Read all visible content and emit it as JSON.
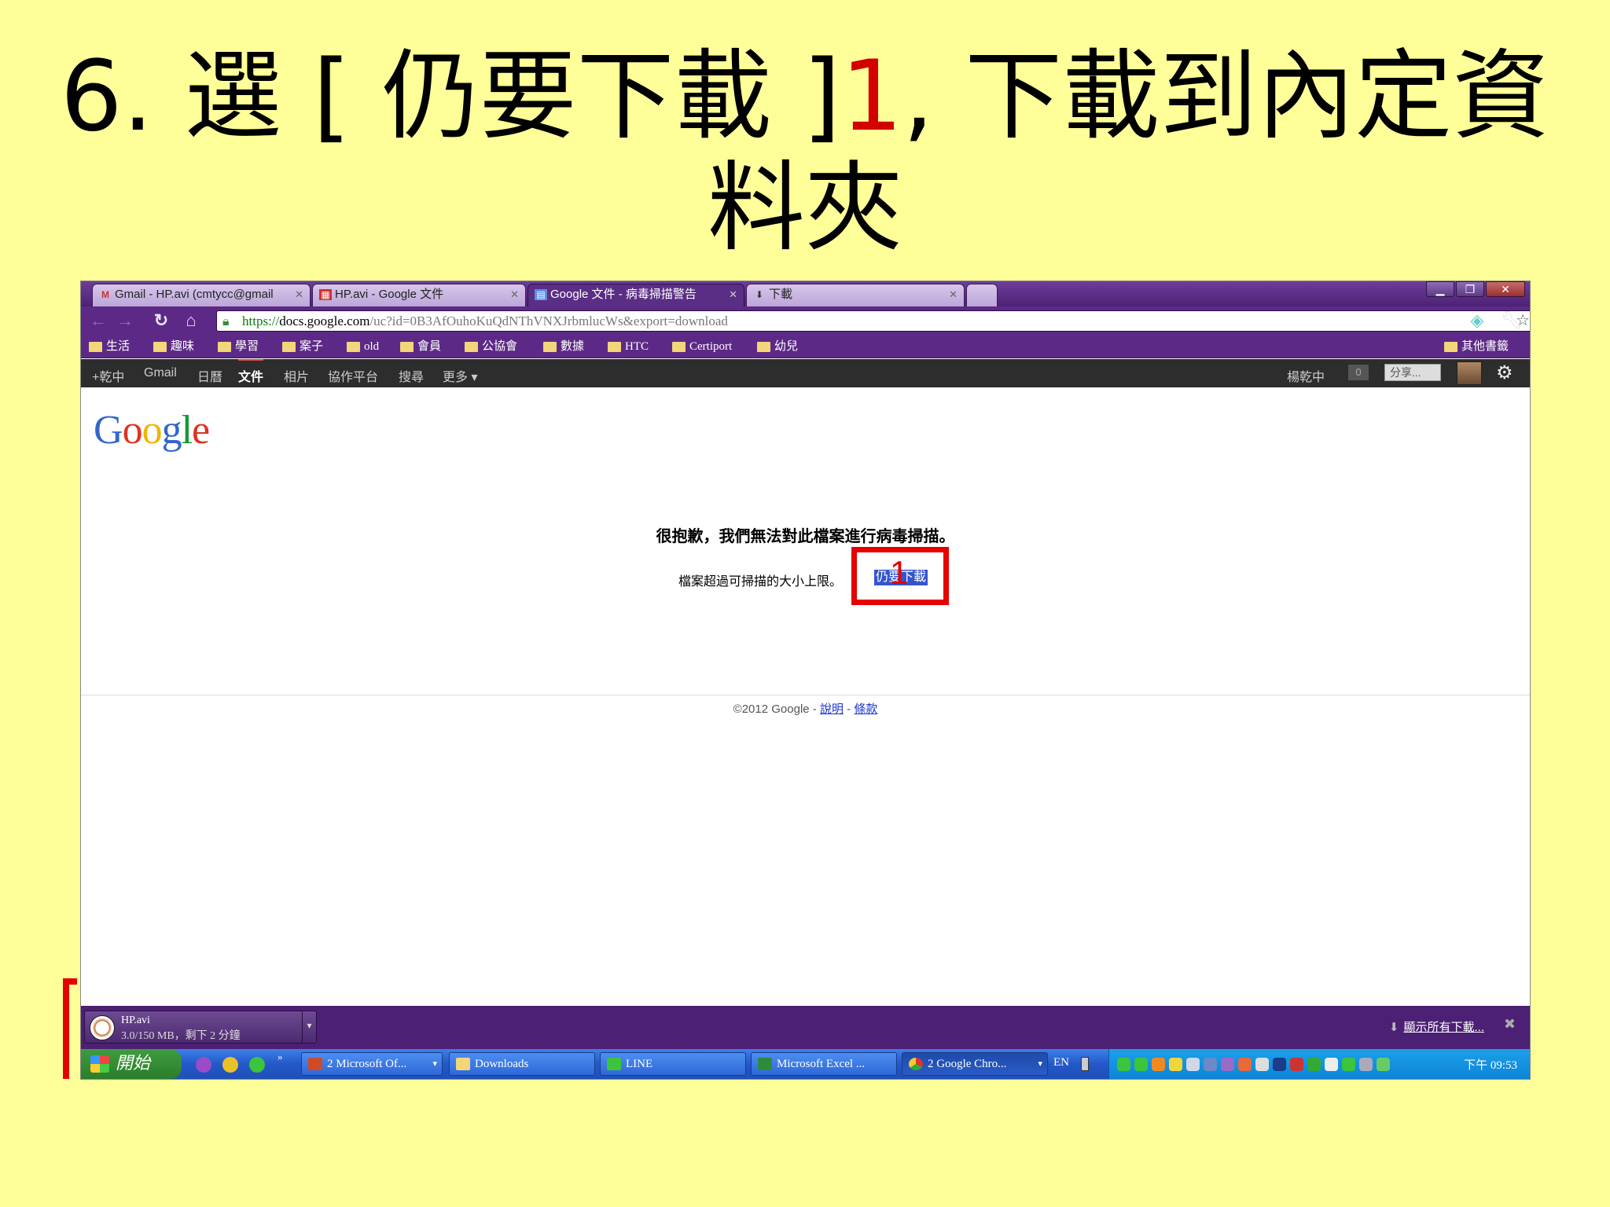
{
  "slide": {
    "title_prefix": "6.  選 [ 仍要下載 ]",
    "title_number": "1",
    "title_suffix": ", 下載到內定資料夾"
  },
  "browser": {
    "tabs": [
      {
        "icon": "gmail-icon",
        "label": "Gmail - HP.avi (cmtycc@gmail",
        "active": false
      },
      {
        "icon": "video-icon",
        "label": "HP.avi - Google 文件",
        "active": false
      },
      {
        "icon": "docs-icon",
        "label": "Google 文件 - 病毒掃描警告",
        "active": true
      },
      {
        "icon": "download-icon",
        "label": "下載",
        "active": false
      }
    ],
    "url": {
      "scheme": "https://",
      "host": "docs.google.com",
      "path": "/uc?id=0B3AfOuhoKuQdNThVNXJrbmlucWs&export=download"
    },
    "bookmarks": [
      "生活",
      "趣味",
      "學習",
      "案子",
      "old",
      "會員",
      "公協會",
      "數據",
      "HTC",
      "Certiport",
      "幼兒"
    ],
    "other_bookmarks": "其他書籤"
  },
  "gbar": {
    "items": [
      "+乾中",
      "Gmail",
      "日曆",
      "文件",
      "相片",
      "協作平台",
      "搜尋",
      "更多 ▾"
    ],
    "selected": "文件",
    "user": "楊乾中",
    "count": "0",
    "share": "分享..."
  },
  "page": {
    "logo_letters": [
      "G",
      "o",
      "o",
      "g",
      "l",
      "e"
    ],
    "heading": "很抱歉，我們無法對此檔案進行病毒掃描。",
    "too_large": "檔案超過可掃描的大小上限。",
    "download_anyway": "仍要下載",
    "step_marker": "1",
    "footer_copyright": "©2012 Google - ",
    "footer_help": "說明",
    "footer_sep": " - ",
    "footer_terms": "條款"
  },
  "download_shelf": {
    "filename": "HP.avi",
    "status": "3.0/150 MB，剩下 2 分鐘",
    "show_all": "顯示所有下載..."
  },
  "taskbar": {
    "start": "開始",
    "buttons": [
      {
        "label": "2 Microsoft Of...",
        "icon": "office-icon",
        "color": "#d04a2a",
        "dropdown": true
      },
      {
        "label": "Downloads",
        "icon": "folder-icon",
        "color": "#f3d57a",
        "dropdown": false
      },
      {
        "label": "LINE",
        "icon": "line-icon",
        "color": "#3cc43c",
        "dropdown": false
      },
      {
        "label": "Microsoft Excel ...",
        "icon": "excel-icon",
        "color": "#2e8b3e",
        "dropdown": false
      },
      {
        "label": "2 Google Chro...",
        "icon": "chrome-icon",
        "color": "#e8c02a",
        "dropdown": true
      }
    ],
    "lang": "EN",
    "clock": "下午 09:53"
  },
  "colors": {
    "slide_bg": "#ffff99",
    "accent_red": "#e60000",
    "chrome_purple": "#5c2a86",
    "link_blue": "#1a33cc"
  }
}
